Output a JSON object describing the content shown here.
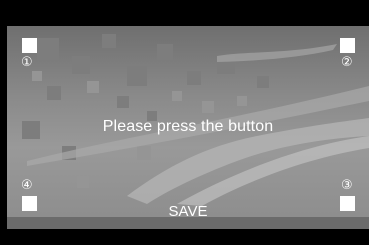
{
  "prompt_text": "Please press the button",
  "save_label": "SAVE",
  "corners": {
    "top_left": "①",
    "top_right": "②",
    "bottom_right": "③",
    "bottom_left": "④"
  },
  "colors": {
    "frame": "#000000",
    "background": "#8a8a8a",
    "text": "#ffffff",
    "touch_target": "#ffffff"
  }
}
